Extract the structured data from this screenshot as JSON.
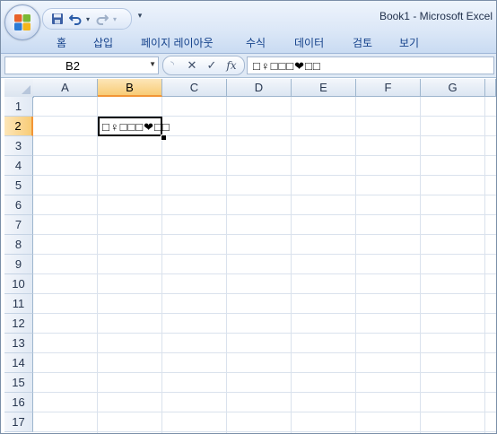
{
  "window": {
    "title": "Book1 - Microsoft Excel"
  },
  "office_button": {
    "icon": "office-logo-icon"
  },
  "quick_access": {
    "icons": [
      "save-icon",
      "undo-icon",
      "undo-dropdown-icon",
      "redo-icon",
      "redo-dropdown-icon",
      "customize-toolbar-icon"
    ],
    "more_glyph": "▾"
  },
  "ribbon": {
    "tabs": [
      {
        "label": "홈"
      },
      {
        "label": "삽입"
      },
      {
        "label": "페이지 레이아웃"
      },
      {
        "label": "수식"
      },
      {
        "label": "데이터"
      },
      {
        "label": "검토"
      },
      {
        "label": "보기"
      }
    ]
  },
  "formula_bar": {
    "name_box": "B2",
    "name_box_arrow": "▼",
    "fx_label": "fx",
    "content": "□♀□□□❤□□"
  },
  "sheet": {
    "columns": [
      "A",
      "B",
      "C",
      "D",
      "E",
      "F",
      "G"
    ],
    "rows": [
      "1",
      "2",
      "3",
      "4",
      "5",
      "6",
      "7",
      "8",
      "9",
      "10",
      "11",
      "12",
      "13",
      "14",
      "15",
      "16",
      "17"
    ],
    "selected_column": "B",
    "selected_row": "2",
    "active_cell": {
      "ref": "B2",
      "value": "□♀□□□❤□□"
    }
  },
  "colors": {
    "selection_header": "#f8cc77",
    "selection_accent": "#f29536",
    "ribbon_tab_text": "#15428b"
  }
}
